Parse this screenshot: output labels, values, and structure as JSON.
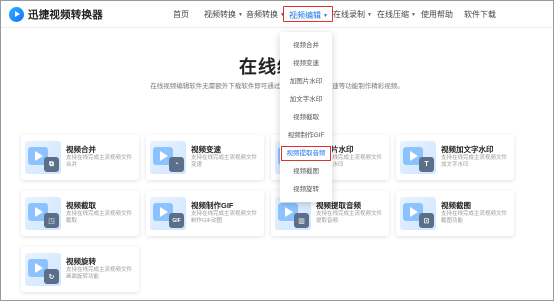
{
  "brand": {
    "name": "迅捷视频转换器"
  },
  "nav": [
    {
      "label": "首页",
      "caret": ""
    },
    {
      "label": "视频转换",
      "caret": "▼"
    },
    {
      "label": "音频转换",
      "caret": "▼"
    },
    {
      "label": "视频编辑",
      "caret": "▼"
    },
    {
      "label": "在线录制",
      "caret": "▼"
    },
    {
      "label": "在线压缩",
      "caret": "▼"
    },
    {
      "label": "使用帮助",
      "caret": ""
    },
    {
      "label": "软件下载",
      "caret": ""
    }
  ],
  "hero": {
    "title": "在线编辑",
    "subtitle": "在线视频编辑软件无需额外下载软件即可通过视频合并、视频变速等功能制作精彩视频。"
  },
  "dropdown": {
    "items": [
      "视频合并",
      "视频变速",
      "加图片水印",
      "加文字水印",
      "视频截取",
      "视频制作GIF",
      "视频提取音频",
      "视频截图",
      "视频旋转"
    ],
    "active_index": 6
  },
  "cards": [
    {
      "title": "视频合并",
      "desc": "支持在线完成主流视频文件合并",
      "badge": "⧉"
    },
    {
      "title": "视频变速",
      "desc": "支持在线完成主流视频文件变速",
      "badge": "◔"
    },
    {
      "title": "加图片水印",
      "desc": "支持在线完成主流视频文件加图片水印",
      "badge": "▣"
    },
    {
      "title": "视频加文字水印",
      "desc": "支持在线完成主流视频文件加文字水印",
      "badge": "T"
    },
    {
      "title": "视频截取",
      "desc": "支持在线完成主流视频文件截取",
      "badge": "◳"
    },
    {
      "title": "视频制作GIF",
      "desc": "支持在线完成主流视频文件制作GIF动图",
      "badge": "GIF"
    },
    {
      "title": "视频提取音频",
      "desc": "支持在线完成主流视频文件提取音频",
      "badge": "▥"
    },
    {
      "title": "视频截图",
      "desc": "支持在线完成主流视频文件截图功能",
      "badge": "⊡"
    },
    {
      "title": "视频旋转",
      "desc": "支持在线完成主流视频文件画面旋转功能",
      "badge": "↻"
    }
  ],
  "colors": {
    "accent": "#1a73e8",
    "highlight_border": "#e53030"
  }
}
